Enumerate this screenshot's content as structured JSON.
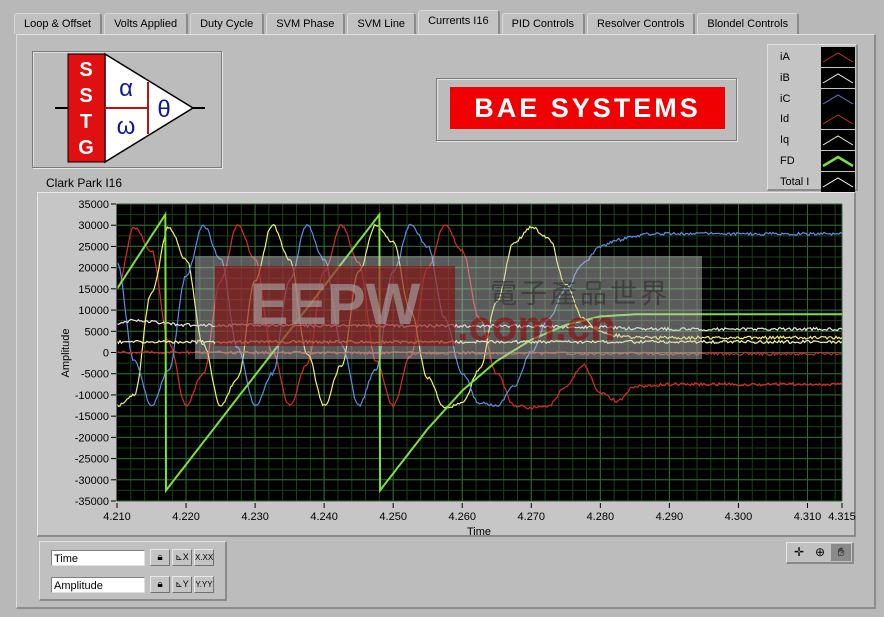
{
  "tabs": [
    {
      "label": "Loop & Offset",
      "active": false
    },
    {
      "label": "Volts Applied",
      "active": false
    },
    {
      "label": "Duty Cycle",
      "active": false
    },
    {
      "label": "SVM Phase",
      "active": false
    },
    {
      "label": "SVM Line",
      "active": false
    },
    {
      "label": "Currents I16",
      "active": true
    },
    {
      "label": "PID Controls",
      "active": false
    },
    {
      "label": "Resolver Controls",
      "active": false
    },
    {
      "label": "Blondel Controls",
      "active": false
    }
  ],
  "logo": {
    "letters": [
      "S",
      "S",
      "T",
      "G"
    ],
    "alpha": "α",
    "omega": "ω",
    "theta": "θ",
    "caption": "Clark Park  I16"
  },
  "brand": {
    "text": "BAE SYSTEMS",
    "color": "#f00000"
  },
  "legend": [
    {
      "name": "iA",
      "color": "#c03030"
    },
    {
      "name": "iB",
      "color": "#f0f0f0"
    },
    {
      "name": "iC",
      "color": "#5a7ed8"
    },
    {
      "name": "Id",
      "color": "#c03030"
    },
    {
      "name": "Iq",
      "color": "#f0f0d0"
    },
    {
      "name": "FD",
      "color": "#7ee03a"
    },
    {
      "name": "Total I",
      "color": "#ffffff"
    }
  ],
  "watermark": {
    "logo": "EEPW",
    "cn": "電子產品世界",
    "domain": ".com.cn"
  },
  "scale_legend": {
    "x_name": "Time",
    "y_name": "Amplitude",
    "x_format": "X.XX",
    "y_format": "Y.YY"
  },
  "chart_data": {
    "type": "line",
    "title": "",
    "xlabel": "Time",
    "ylabel": "Amplitude",
    "xlim": [
      4.21,
      4.315
    ],
    "ylim": [
      -35000,
      35000
    ],
    "grid": true,
    "background": "#000000",
    "grid_color": "#2f6a2f",
    "x_ticks": [
      "4.210",
      "4.220",
      "4.230",
      "4.240",
      "4.250",
      "4.260",
      "4.270",
      "4.280",
      "4.290",
      "4.300",
      "4.310",
      "4.315"
    ],
    "x_tick_values": [
      4.21,
      4.22,
      4.23,
      4.24,
      4.25,
      4.26,
      4.27,
      4.28,
      4.29,
      4.3,
      4.31,
      4.315
    ],
    "y_ticks": [
      "35000",
      "30000",
      "25000",
      "20000",
      "15000",
      "10000",
      "5000",
      "0",
      "-5000",
      "-10000",
      "-15000",
      "-20000",
      "-25000",
      "-30000",
      "-35000"
    ],
    "y_tick_values": [
      35000,
      30000,
      25000,
      20000,
      15000,
      10000,
      5000,
      0,
      -5000,
      -10000,
      -15000,
      -20000,
      -25000,
      -30000,
      -35000
    ],
    "series": [
      {
        "name": "iA",
        "color": "#e02a2a",
        "x": [
          4.21,
          4.2125,
          4.215,
          4.2175,
          4.22,
          4.2225,
          4.225,
          4.2275,
          4.23,
          4.2325,
          4.235,
          4.2375,
          4.24,
          4.2425,
          4.245,
          4.2475,
          4.25,
          4.2525,
          4.255,
          4.2575,
          4.26,
          4.2625,
          4.265,
          4.2675,
          4.27,
          4.2725,
          4.275,
          4.2775,
          4.28,
          4.2825,
          4.285,
          4.29,
          4.295,
          4.3,
          4.305,
          4.31,
          4.315
        ],
        "y": [
          15000,
          29500,
          24000,
          2500,
          -12500,
          -5000,
          17000,
          30000,
          22000,
          0,
          -12500,
          -3000,
          19000,
          30000,
          21000,
          -2000,
          -12500,
          -1000,
          20000,
          30000,
          24000,
          8000,
          -5000,
          -12500,
          -13000,
          -12500,
          -8000,
          -3000,
          -9500,
          -11500,
          -8000,
          -7500,
          -7500,
          -7500,
          -7500,
          -7500,
          -7500
        ]
      },
      {
        "name": "iB",
        "color": "#f5f06a",
        "x": [
          4.21,
          4.2125,
          4.215,
          4.2175,
          4.22,
          4.2225,
          4.225,
          4.2275,
          4.23,
          4.2325,
          4.235,
          4.2375,
          4.24,
          4.2425,
          4.245,
          4.2475,
          4.25,
          4.2525,
          4.255,
          4.2575,
          4.26,
          4.2625,
          4.265,
          4.2675,
          4.27,
          4.2725,
          4.275,
          4.2775,
          4.28,
          4.2825,
          4.285,
          4.29,
          4.295,
          4.3,
          4.305,
          4.31,
          4.315
        ],
        "y": [
          -12500,
          -10000,
          14000,
          29500,
          22000,
          2000,
          -12500,
          -6000,
          17000,
          30000,
          22000,
          0,
          -12500,
          -3000,
          19000,
          30000,
          26000,
          10000,
          -6000,
          -13000,
          -12000,
          -4000,
          12000,
          26000,
          29500,
          27000,
          16000,
          8000,
          5000,
          4000,
          3500,
          3500,
          3500,
          3500,
          3500,
          3500,
          3500
        ]
      },
      {
        "name": "iC",
        "color": "#5a8ee8",
        "x": [
          4.21,
          4.2125,
          4.215,
          4.2175,
          4.22,
          4.2225,
          4.225,
          4.2275,
          4.23,
          4.2325,
          4.235,
          4.2375,
          4.24,
          4.2425,
          4.245,
          4.2475,
          4.25,
          4.2525,
          4.255,
          4.2575,
          4.26,
          4.2625,
          4.265,
          4.2675,
          4.27,
          4.2725,
          4.275,
          4.2775,
          4.28,
          4.2825,
          4.285,
          4.2875,
          4.29,
          4.295,
          4.3,
          4.305,
          4.31,
          4.315
        ],
        "y": [
          21000,
          -2000,
          -12500,
          -4000,
          18000,
          30000,
          22000,
          1000,
          -12500,
          -5000,
          17000,
          30000,
          22000,
          2000,
          -12500,
          -4000,
          19000,
          30000,
          25000,
          8000,
          -5000,
          -12000,
          -12500,
          -8000,
          0,
          8000,
          15000,
          21000,
          25000,
          26500,
          27500,
          28000,
          28000,
          28000,
          28000,
          28000,
          28000,
          28000
        ]
      },
      {
        "name": "Id",
        "color": "#c83030",
        "x": [
          4.21,
          4.315
        ],
        "y": [
          0,
          -300
        ]
      },
      {
        "name": "Iq",
        "color": "#f0e4e4",
        "x": [
          4.21,
          4.212,
          4.22,
          4.24,
          4.26,
          4.28,
          4.285,
          4.29,
          4.315
        ],
        "y": [
          6500,
          7500,
          6500,
          6300,
          6300,
          6000,
          5600,
          5500,
          5500
        ]
      },
      {
        "name": "FD",
        "color": "#7ee03a",
        "x": [
          4.21,
          4.217,
          4.2171,
          4.248,
          4.2481,
          4.255,
          4.26,
          4.265,
          4.27,
          4.275,
          4.28,
          4.285,
          4.29,
          4.315
        ],
        "y": [
          15000,
          32500,
          -32500,
          32500,
          -32500,
          -18000,
          -9000,
          -2000,
          3000,
          6500,
          8500,
          9000,
          9000,
          9000
        ]
      },
      {
        "name": "Total I",
        "color": "#f8f0b0",
        "x": [
          4.21,
          4.315
        ],
        "y": [
          2500,
          2500
        ]
      }
    ]
  }
}
